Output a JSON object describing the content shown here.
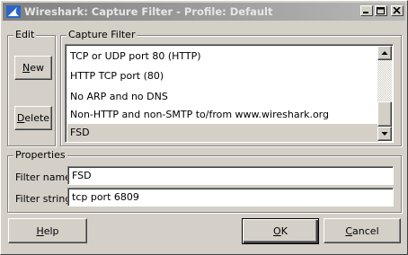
{
  "window": {
    "title": "Wireshark: Capture Filter - Profile: Default",
    "controls": [
      "minimize-icon",
      "maximize-icon",
      "close-icon"
    ]
  },
  "edit_group": {
    "label": "Edit",
    "new_button": {
      "mnemonic": "N",
      "rest": "ew"
    },
    "delete_button": {
      "mnemonic": "D",
      "rest": "elete"
    }
  },
  "capture_filter_group": {
    "label": "Capture Filter",
    "items": [
      {
        "label": "TCP or UDP port 80 (HTTP)",
        "selected": false
      },
      {
        "label": "HTTP TCP port (80)",
        "selected": false
      },
      {
        "label": "No ARP and no DNS",
        "selected": false
      },
      {
        "label": "Non-HTTP and non-SMTP to/from www.wireshark.org",
        "selected": false
      },
      {
        "label": "FSD",
        "selected": true
      }
    ]
  },
  "properties_group": {
    "label": "Properties",
    "filter_name_label": "Filter name:",
    "filter_name_value": "FSD",
    "filter_string_label": "Filter string:",
    "filter_string_value": "tcp port 6809"
  },
  "footer": {
    "help_button": {
      "mnemonic": "H",
      "rest": "elp"
    },
    "ok_button": {
      "mnemonic": "O",
      "rest": "K"
    },
    "cancel_button": {
      "mnemonic": "C",
      "rest": "ancel"
    }
  }
}
